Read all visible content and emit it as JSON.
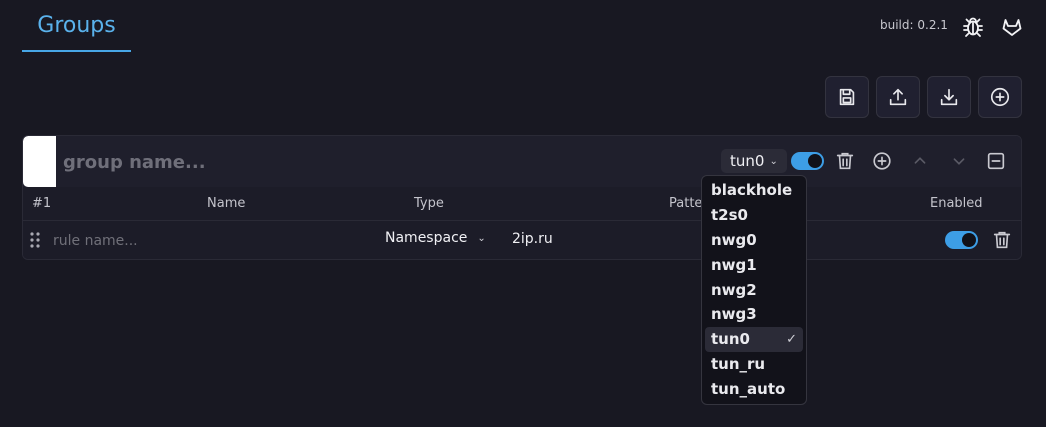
{
  "header": {
    "tab_label": "Groups",
    "build_text": "build: 0.2.1",
    "icons": [
      "bug-icon",
      "gitlab-icon"
    ]
  },
  "toolbar": {
    "buttons": [
      "save-icon",
      "upload-icon",
      "download-icon",
      "add-circle-icon"
    ]
  },
  "group": {
    "color": "#ffffff",
    "name_placeholder": "group name...",
    "name_value": "",
    "interface_selected": "tun0",
    "enabled": true,
    "columns": [
      "#1",
      "Name",
      "Type",
      "Patte",
      "Enabled"
    ],
    "rules": [
      {
        "name_placeholder": "rule name...",
        "name_value": "",
        "type": "Namespace",
        "pattern": "2ip.ru",
        "enabled": true
      }
    ]
  },
  "dropdown": {
    "options": [
      "blackhole",
      "t2s0",
      "nwg0",
      "nwg1",
      "nwg2",
      "nwg3",
      "tun0",
      "tun_ru",
      "tun_auto"
    ],
    "selected": "tun0",
    "check_glyph": "✓"
  },
  "colors": {
    "accent": "#47a6e6",
    "background": "#181822",
    "toggle": "#3d9ee6"
  }
}
